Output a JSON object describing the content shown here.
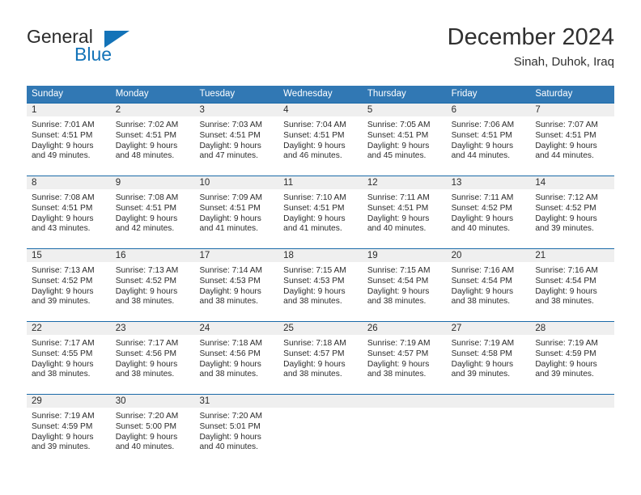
{
  "brand": {
    "name_part1": "General",
    "name_part2": "Blue",
    "logo_icon": "triangle-logo-icon"
  },
  "header": {
    "month_title": "December 2024",
    "location": "Sinah, Duhok, Iraq"
  },
  "theme": {
    "header_blue": "#3178b4",
    "row_border_blue": "#1a6aa8",
    "day_band_gray": "#efefef",
    "brand_blue": "#1373b8",
    "text": "#2b2b2b"
  },
  "weekdays": [
    "Sunday",
    "Monday",
    "Tuesday",
    "Wednesday",
    "Thursday",
    "Friday",
    "Saturday"
  ],
  "weeks": [
    [
      {
        "day": "1",
        "sunrise": "Sunrise: 7:01 AM",
        "sunset": "Sunset: 4:51 PM",
        "daylight1": "Daylight: 9 hours",
        "daylight2": "and 49 minutes."
      },
      {
        "day": "2",
        "sunrise": "Sunrise: 7:02 AM",
        "sunset": "Sunset: 4:51 PM",
        "daylight1": "Daylight: 9 hours",
        "daylight2": "and 48 minutes."
      },
      {
        "day": "3",
        "sunrise": "Sunrise: 7:03 AM",
        "sunset": "Sunset: 4:51 PM",
        "daylight1": "Daylight: 9 hours",
        "daylight2": "and 47 minutes."
      },
      {
        "day": "4",
        "sunrise": "Sunrise: 7:04 AM",
        "sunset": "Sunset: 4:51 PM",
        "daylight1": "Daylight: 9 hours",
        "daylight2": "and 46 minutes."
      },
      {
        "day": "5",
        "sunrise": "Sunrise: 7:05 AM",
        "sunset": "Sunset: 4:51 PM",
        "daylight1": "Daylight: 9 hours",
        "daylight2": "and 45 minutes."
      },
      {
        "day": "6",
        "sunrise": "Sunrise: 7:06 AM",
        "sunset": "Sunset: 4:51 PM",
        "daylight1": "Daylight: 9 hours",
        "daylight2": "and 44 minutes."
      },
      {
        "day": "7",
        "sunrise": "Sunrise: 7:07 AM",
        "sunset": "Sunset: 4:51 PM",
        "daylight1": "Daylight: 9 hours",
        "daylight2": "and 44 minutes."
      }
    ],
    [
      {
        "day": "8",
        "sunrise": "Sunrise: 7:08 AM",
        "sunset": "Sunset: 4:51 PM",
        "daylight1": "Daylight: 9 hours",
        "daylight2": "and 43 minutes."
      },
      {
        "day": "9",
        "sunrise": "Sunrise: 7:08 AM",
        "sunset": "Sunset: 4:51 PM",
        "daylight1": "Daylight: 9 hours",
        "daylight2": "and 42 minutes."
      },
      {
        "day": "10",
        "sunrise": "Sunrise: 7:09 AM",
        "sunset": "Sunset: 4:51 PM",
        "daylight1": "Daylight: 9 hours",
        "daylight2": "and 41 minutes."
      },
      {
        "day": "11",
        "sunrise": "Sunrise: 7:10 AM",
        "sunset": "Sunset: 4:51 PM",
        "daylight1": "Daylight: 9 hours",
        "daylight2": "and 41 minutes."
      },
      {
        "day": "12",
        "sunrise": "Sunrise: 7:11 AM",
        "sunset": "Sunset: 4:51 PM",
        "daylight1": "Daylight: 9 hours",
        "daylight2": "and 40 minutes."
      },
      {
        "day": "13",
        "sunrise": "Sunrise: 7:11 AM",
        "sunset": "Sunset: 4:52 PM",
        "daylight1": "Daylight: 9 hours",
        "daylight2": "and 40 minutes."
      },
      {
        "day": "14",
        "sunrise": "Sunrise: 7:12 AM",
        "sunset": "Sunset: 4:52 PM",
        "daylight1": "Daylight: 9 hours",
        "daylight2": "and 39 minutes."
      }
    ],
    [
      {
        "day": "15",
        "sunrise": "Sunrise: 7:13 AM",
        "sunset": "Sunset: 4:52 PM",
        "daylight1": "Daylight: 9 hours",
        "daylight2": "and 39 minutes."
      },
      {
        "day": "16",
        "sunrise": "Sunrise: 7:13 AM",
        "sunset": "Sunset: 4:52 PM",
        "daylight1": "Daylight: 9 hours",
        "daylight2": "and 38 minutes."
      },
      {
        "day": "17",
        "sunrise": "Sunrise: 7:14 AM",
        "sunset": "Sunset: 4:53 PM",
        "daylight1": "Daylight: 9 hours",
        "daylight2": "and 38 minutes."
      },
      {
        "day": "18",
        "sunrise": "Sunrise: 7:15 AM",
        "sunset": "Sunset: 4:53 PM",
        "daylight1": "Daylight: 9 hours",
        "daylight2": "and 38 minutes."
      },
      {
        "day": "19",
        "sunrise": "Sunrise: 7:15 AM",
        "sunset": "Sunset: 4:54 PM",
        "daylight1": "Daylight: 9 hours",
        "daylight2": "and 38 minutes."
      },
      {
        "day": "20",
        "sunrise": "Sunrise: 7:16 AM",
        "sunset": "Sunset: 4:54 PM",
        "daylight1": "Daylight: 9 hours",
        "daylight2": "and 38 minutes."
      },
      {
        "day": "21",
        "sunrise": "Sunrise: 7:16 AM",
        "sunset": "Sunset: 4:54 PM",
        "daylight1": "Daylight: 9 hours",
        "daylight2": "and 38 minutes."
      }
    ],
    [
      {
        "day": "22",
        "sunrise": "Sunrise: 7:17 AM",
        "sunset": "Sunset: 4:55 PM",
        "daylight1": "Daylight: 9 hours",
        "daylight2": "and 38 minutes."
      },
      {
        "day": "23",
        "sunrise": "Sunrise: 7:17 AM",
        "sunset": "Sunset: 4:56 PM",
        "daylight1": "Daylight: 9 hours",
        "daylight2": "and 38 minutes."
      },
      {
        "day": "24",
        "sunrise": "Sunrise: 7:18 AM",
        "sunset": "Sunset: 4:56 PM",
        "daylight1": "Daylight: 9 hours",
        "daylight2": "and 38 minutes."
      },
      {
        "day": "25",
        "sunrise": "Sunrise: 7:18 AM",
        "sunset": "Sunset: 4:57 PM",
        "daylight1": "Daylight: 9 hours",
        "daylight2": "and 38 minutes."
      },
      {
        "day": "26",
        "sunrise": "Sunrise: 7:19 AM",
        "sunset": "Sunset: 4:57 PM",
        "daylight1": "Daylight: 9 hours",
        "daylight2": "and 38 minutes."
      },
      {
        "day": "27",
        "sunrise": "Sunrise: 7:19 AM",
        "sunset": "Sunset: 4:58 PM",
        "daylight1": "Daylight: 9 hours",
        "daylight2": "and 39 minutes."
      },
      {
        "day": "28",
        "sunrise": "Sunrise: 7:19 AM",
        "sunset": "Sunset: 4:59 PM",
        "daylight1": "Daylight: 9 hours",
        "daylight2": "and 39 minutes."
      }
    ],
    [
      {
        "day": "29",
        "sunrise": "Sunrise: 7:19 AM",
        "sunset": "Sunset: 4:59 PM",
        "daylight1": "Daylight: 9 hours",
        "daylight2": "and 39 minutes."
      },
      {
        "day": "30",
        "sunrise": "Sunrise: 7:20 AM",
        "sunset": "Sunset: 5:00 PM",
        "daylight1": "Daylight: 9 hours",
        "daylight2": "and 40 minutes."
      },
      {
        "day": "31",
        "sunrise": "Sunrise: 7:20 AM",
        "sunset": "Sunset: 5:01 PM",
        "daylight1": "Daylight: 9 hours",
        "daylight2": "and 40 minutes."
      },
      {
        "day": "",
        "sunrise": "",
        "sunset": "",
        "daylight1": "",
        "daylight2": ""
      },
      {
        "day": "",
        "sunrise": "",
        "sunset": "",
        "daylight1": "",
        "daylight2": ""
      },
      {
        "day": "",
        "sunrise": "",
        "sunset": "",
        "daylight1": "",
        "daylight2": ""
      },
      {
        "day": "",
        "sunrise": "",
        "sunset": "",
        "daylight1": "",
        "daylight2": ""
      }
    ]
  ]
}
